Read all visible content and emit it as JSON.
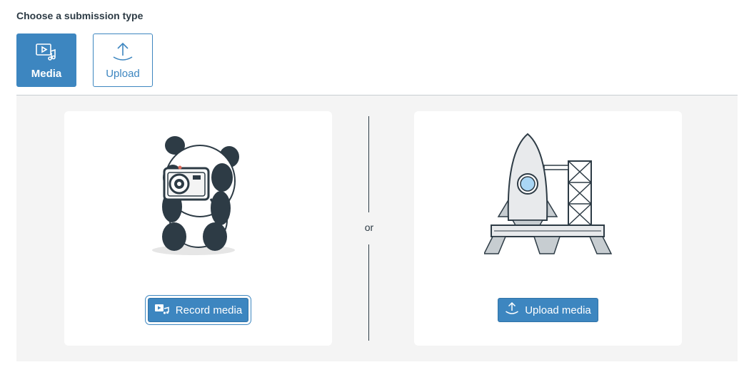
{
  "heading": "Choose a submission type",
  "types": {
    "media": {
      "label": "Media",
      "icon": "media-icon",
      "selected": true
    },
    "upload": {
      "label": "Upload",
      "icon": "upload-icon",
      "selected": false
    }
  },
  "separator": "or",
  "record": {
    "button_label": "Record media",
    "icon": "record-media-icon",
    "illustration": "panda-with-camera"
  },
  "upload_media": {
    "button_label": "Upload media",
    "icon": "upload-icon",
    "illustration": "rocket-on-launchpad"
  },
  "colors": {
    "accent": "#3d86c0",
    "panel_bg": "#f4f4f4",
    "text": "#2d3b45"
  }
}
